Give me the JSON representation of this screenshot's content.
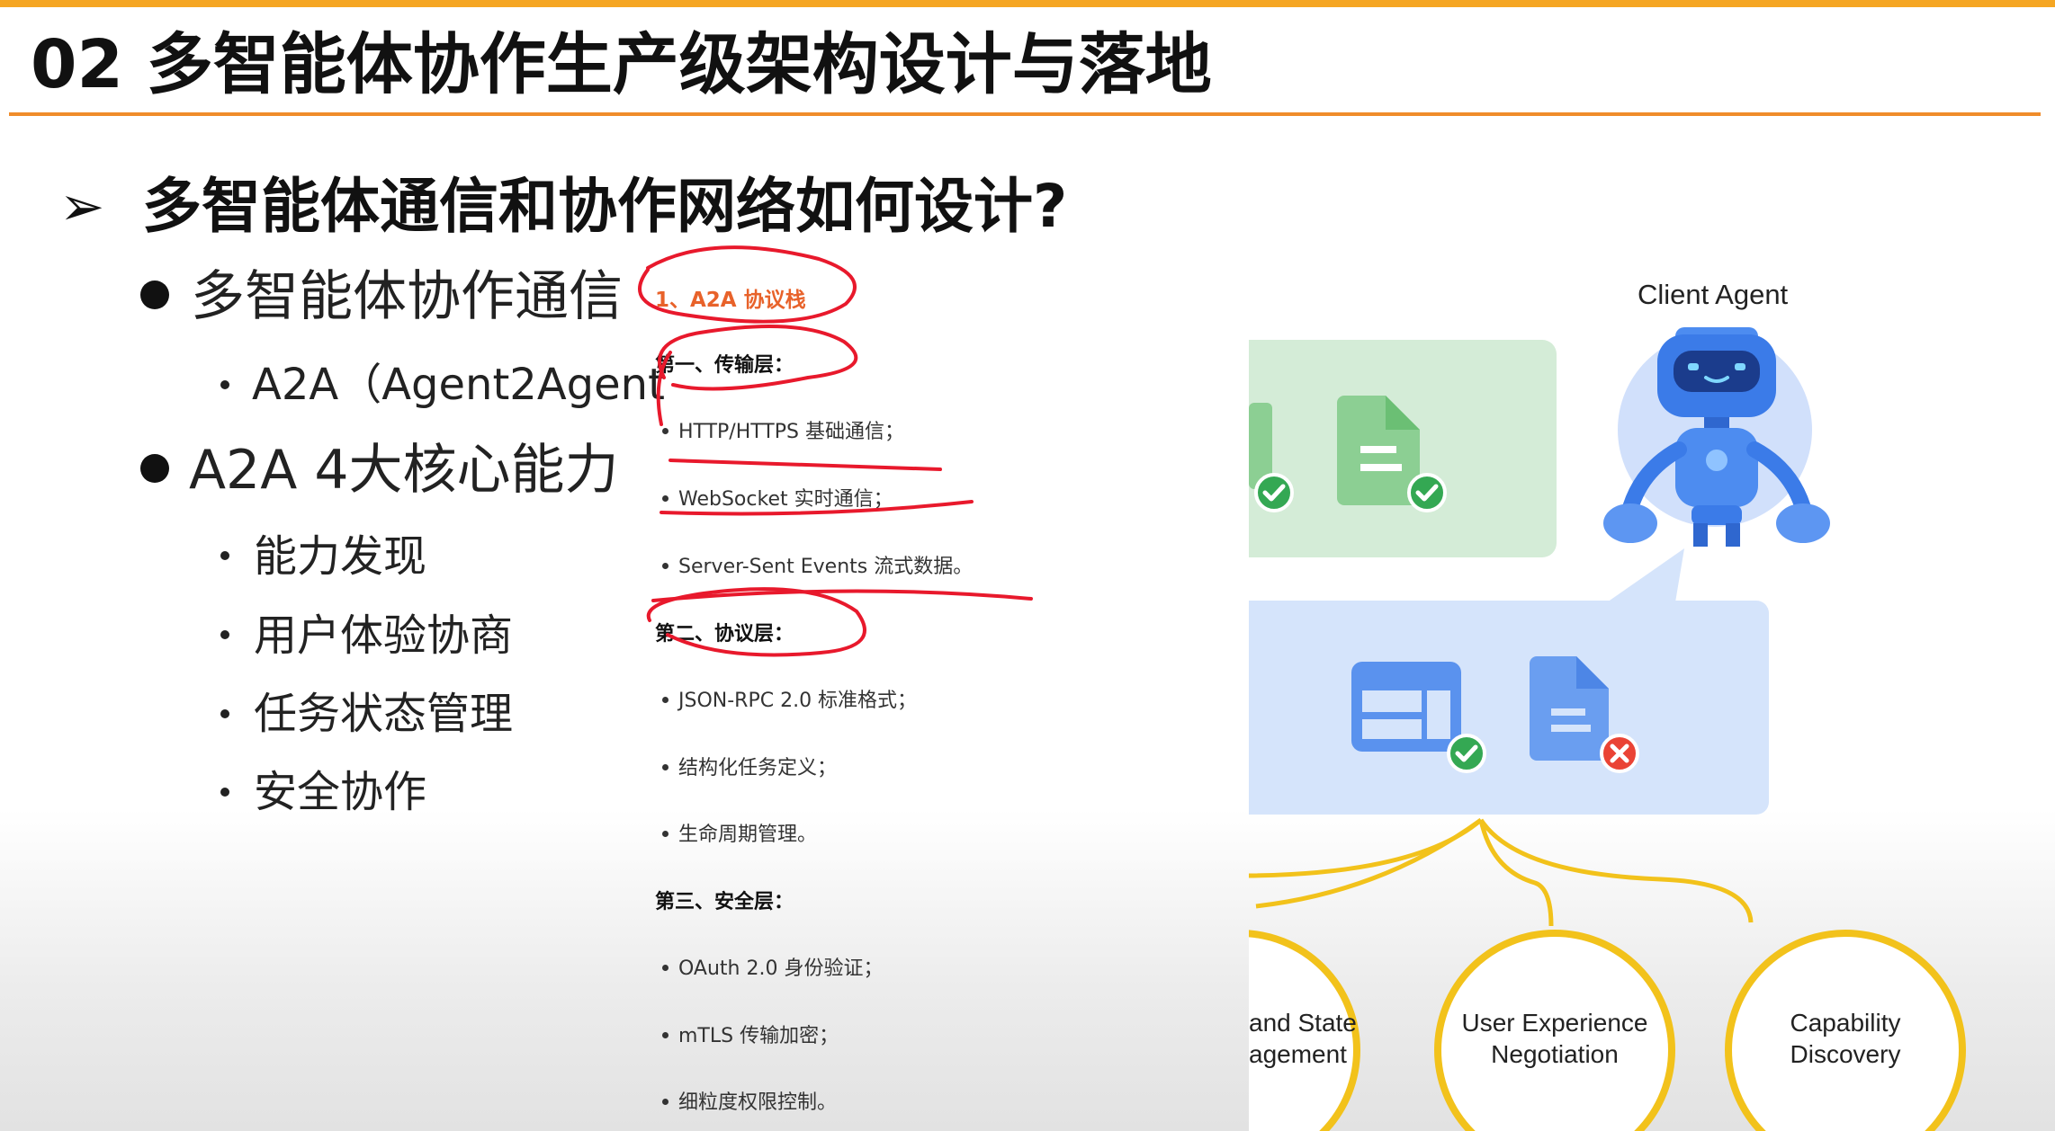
{
  "title": "02 多智能体协作生产级架构设计与落地",
  "heading": "多智能体通信和协作网络如何设计?",
  "bullets": {
    "b1": "多智能体协作通信",
    "b1_sub": "A2A（Agent2Agent",
    "b2": "A2A 4大核心能力",
    "b2_subs": [
      "能力发现",
      "用户体验协商",
      "任务状态管理",
      "安全协作"
    ]
  },
  "doc": {
    "stack_title": "1、A2A 协议栈",
    "section1": "第一、传输层：",
    "section1_items": [
      "HTTP/HTTPS 基础通信；",
      "WebSocket 实时通信；",
      "Server-Sent Events 流式数据。"
    ],
    "section2": "第二、协议层：",
    "section2_items": [
      "JSON-RPC 2.0 标准格式；",
      "结构化任务定义；",
      "生命周期管理。"
    ],
    "section3": "第三、安全层：",
    "section3_items": [
      "OAuth 2.0 身份验证；",
      "mTLS 传输加密；",
      "细粒度权限控制。"
    ]
  },
  "illustration": {
    "client_agent": "Client Agent",
    "circle1": [
      "and State",
      "agement"
    ],
    "circle2": [
      "User Experience",
      "Negotiation"
    ],
    "circle3": [
      "Capability",
      "Discovery"
    ]
  },
  "colors": {
    "accent_orange": "#f08c2a",
    "annotation_red": "#e8192c",
    "green_panel": "#d4ecd7",
    "blue_panel": "#d5e4fb",
    "circle_gold": "#f2c21b",
    "check_green": "#34a853",
    "error_red": "#ea4335"
  }
}
